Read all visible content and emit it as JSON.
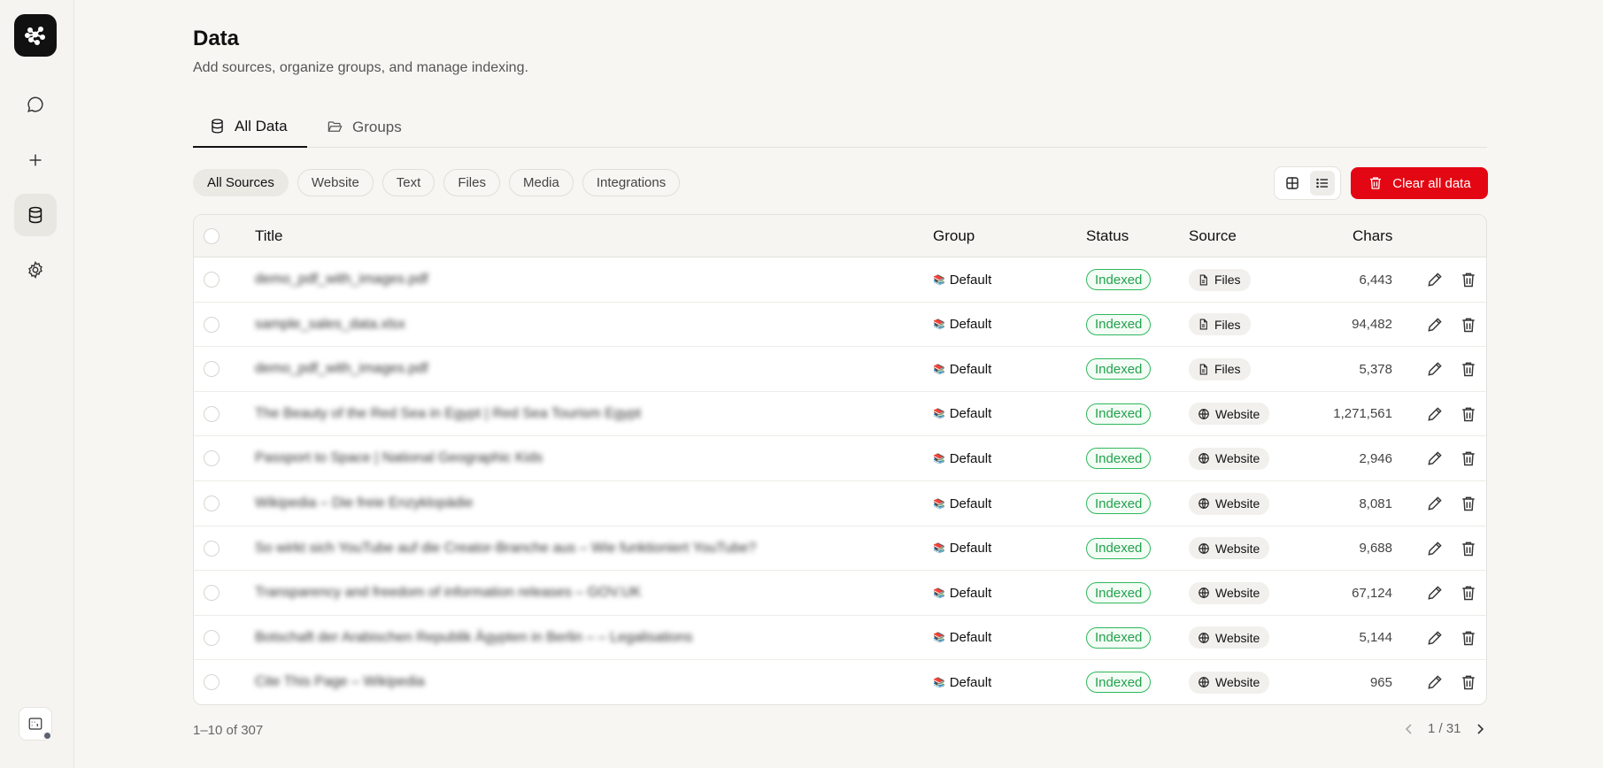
{
  "sidebar": {
    "items": [
      {
        "name": "chat-icon"
      },
      {
        "name": "plus-icon"
      },
      {
        "name": "database-icon"
      },
      {
        "name": "gear-icon"
      }
    ]
  },
  "header": {
    "title": "Data",
    "subtitle": "Add sources, organize groups, and manage indexing."
  },
  "tabs": [
    {
      "label": "All Data",
      "icon": "database-icon",
      "active": true
    },
    {
      "label": "Groups",
      "icon": "folder-open-icon",
      "active": false
    }
  ],
  "filters": [
    "All Sources",
    "Website",
    "Text",
    "Files",
    "Media",
    "Integrations"
  ],
  "toolbar": {
    "clear_label": "Clear all data",
    "accent": "#e30613"
  },
  "table": {
    "columns": {
      "title": "Title",
      "group": "Group",
      "status": "Status",
      "source": "Source",
      "chars": "Chars"
    },
    "rows": [
      {
        "title": "demo_pdf_with_images.pdf",
        "group": "Default",
        "status": "Indexed",
        "source": "Files",
        "chars": "6,443"
      },
      {
        "title": "sample_sales_data.xlsx",
        "group": "Default",
        "status": "Indexed",
        "source": "Files",
        "chars": "94,482"
      },
      {
        "title": "demo_pdf_with_images.pdf",
        "group": "Default",
        "status": "Indexed",
        "source": "Files",
        "chars": "5,378"
      },
      {
        "title": "The Beauty of the Red Sea in Egypt | Red Sea Tourism Egypt",
        "group": "Default",
        "status": "Indexed",
        "source": "Website",
        "chars": "1,271,561"
      },
      {
        "title": "Passport to Space | National Geographic Kids",
        "group": "Default",
        "status": "Indexed",
        "source": "Website",
        "chars": "2,946"
      },
      {
        "title": "Wikipedia – Die freie Enzyklopädie",
        "group": "Default",
        "status": "Indexed",
        "source": "Website",
        "chars": "8,081"
      },
      {
        "title": "So wirkt sich YouTube auf die Creator-Branche aus – Wie funktioniert YouTube?",
        "group": "Default",
        "status": "Indexed",
        "source": "Website",
        "chars": "9,688"
      },
      {
        "title": "Transparency and freedom of information releases – GOV.UK",
        "group": "Default",
        "status": "Indexed",
        "source": "Website",
        "chars": "67,124"
      },
      {
        "title": "Botschaft der Arabischen Republik Ägypten in Berlin – – Legalisations",
        "group": "Default",
        "status": "Indexed",
        "source": "Website",
        "chars": "5,144"
      },
      {
        "title": "Cite This Page – Wikipedia",
        "group": "Default",
        "status": "Indexed",
        "source": "Website",
        "chars": "965"
      }
    ]
  },
  "footer": {
    "count": "1–10 of 307",
    "page": "1 / 31"
  }
}
